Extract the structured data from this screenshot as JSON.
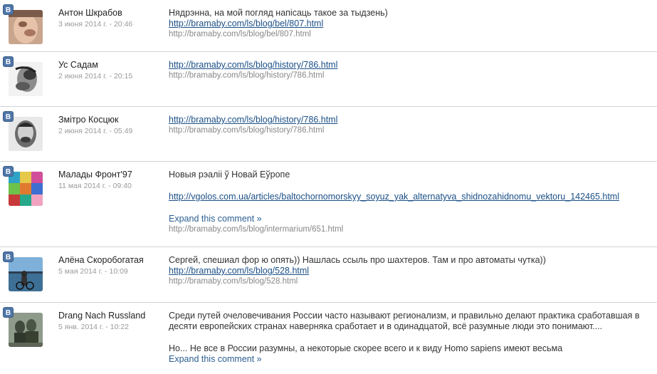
{
  "badge_letter": "B",
  "comments": [
    {
      "author": "Антон Шкрабов",
      "date": "3 июня 2014 г. - 20:46",
      "text": "Нядрэнна, на мой погляд напісаць такое за тыдзень)",
      "link": "http://bramaby.com/ls/blog/bel/807.html",
      "source": "http://bramaby.com/ls/blog/bel/807.html"
    },
    {
      "author": "Ус Садам",
      "date": "2 июня 2014 г. - 20:15",
      "link": "http://bramaby.com/ls/blog/history/786.html",
      "source": "http://bramaby.com/ls/blog/history/786.html"
    },
    {
      "author": "Змітро Косцюк",
      "date": "2 июня 2014 г. - 05:49",
      "link": "http://bramaby.com/ls/blog/history/786.html",
      "source": "http://bramaby.com/ls/blog/history/786.html"
    },
    {
      "author": "Малады Фронт'97",
      "date": "11 мая 2014 г. - 09:40",
      "text": "Новыя рэаліі ў Новай Еўропе",
      "link": "http://vgolos.com.ua/articles/baltochornomorskyy_soyuz_yak_alternatyva_shidnozahidnomu_vektoru_142465.html",
      "expand": "Expand this comment »",
      "source": "http://bramaby.com/ls/blog/intermarium/651.html"
    },
    {
      "author": "Алёна Скоробогатая",
      "date": "5 мая 2014 г. - 10:09",
      "text": "Сергей, спешиал фор ю опять)) Нашлась ссыль про шахтеров. Там и про автоматы чутка))",
      "link": "http://bramaby.com/ls/blog/528.html",
      "source": "http://bramaby.com/ls/blog/528.html"
    },
    {
      "author": "Drang Nach Russland",
      "date": "5 янв. 2014 г. - 10:22",
      "text": "Среди путей очеловечивания России часто называют регионализм, и правильно делают практика сработавшая в десяти европейских странах наверняка сработает и в одинадцатой, всё разумные люди это понимают....",
      "text2": "Но... Не все в России разумны, а некоторые скорее всего и к виду Homo sapiens имеют весьма",
      "expand": "Expand this comment »"
    }
  ]
}
